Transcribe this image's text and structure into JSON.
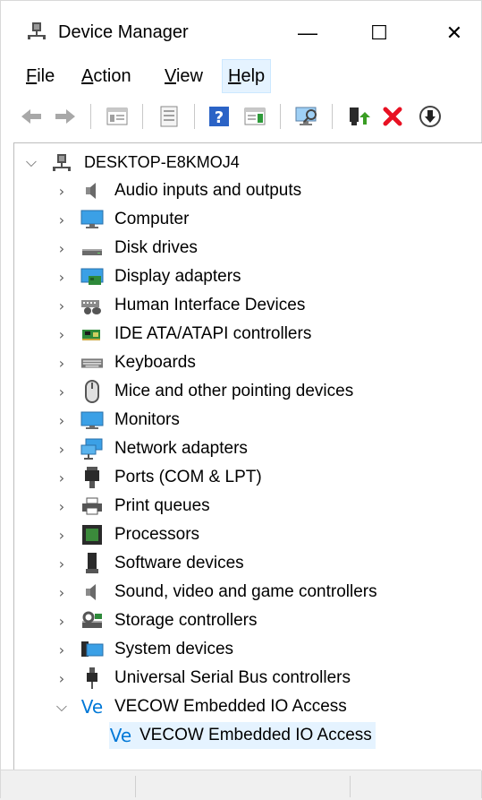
{
  "window": {
    "title": "Device Manager",
    "min_glyph": "—",
    "max_glyph": "☐",
    "close_glyph": "✕"
  },
  "menu": [
    {
      "accel": "F",
      "rest": "ile"
    },
    {
      "accel": "A",
      "rest": "ction"
    },
    {
      "accel": "V",
      "rest": "iew"
    },
    {
      "accel": "H",
      "rest": "elp"
    }
  ],
  "tree": {
    "root": "DESKTOP-E8KMOJ4",
    "categories": [
      "Audio inputs and outputs",
      "Computer",
      "Disk drives",
      "Display adapters",
      "Human Interface Devices",
      "IDE ATA/ATAPI controllers",
      "Keyboards",
      "Mice and other pointing devices",
      "Monitors",
      "Network adapters",
      "Ports (COM & LPT)",
      "Print queues",
      "Processors",
      "Software devices",
      "Sound, video and game controllers",
      "Storage controllers",
      "System devices",
      "Universal Serial Bus controllers",
      "VECOW Embedded IO Access"
    ],
    "expanded_child": "VECOW Embedded IO Access",
    "vecow_logo": "Ve"
  },
  "colors": {
    "accent": "#0078d7",
    "selection": "#e5f3ff",
    "remove_red": "#e81123",
    "enable_green": "#3a9d23"
  }
}
